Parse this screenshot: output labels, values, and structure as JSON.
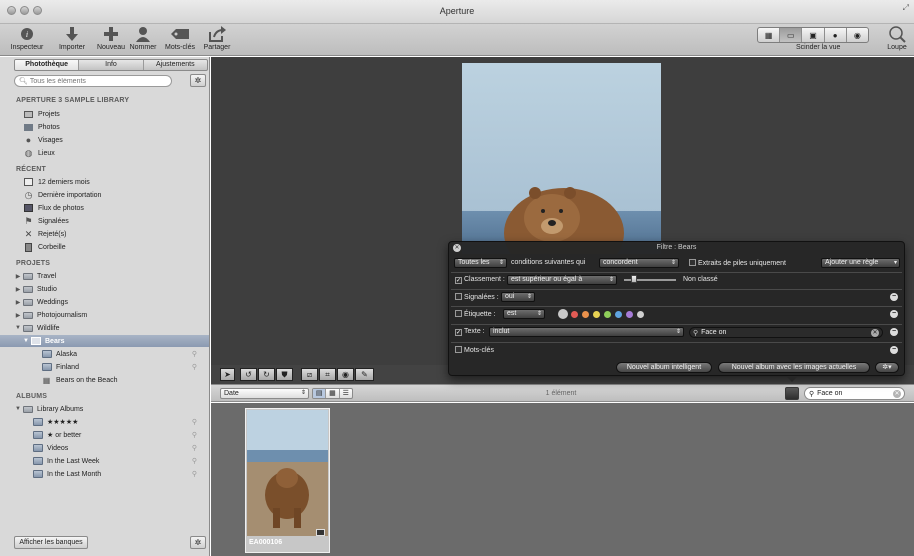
{
  "window": {
    "title": "Aperture"
  },
  "toolbar": {
    "inspector": "Inspecteur",
    "import": "Importer",
    "new": "Nouveau",
    "name": "Nommer",
    "keywords": "Mots-clés",
    "share": "Partager",
    "split_view": "Scinder la vue",
    "loupe": "Loupe"
  },
  "sidebar": {
    "tabs": [
      "Photothèque",
      "Info",
      "Ajustements"
    ],
    "search_placeholder": "Tous les éléments",
    "sections": {
      "library": "APERTURE 3 SAMPLE LIBRARY",
      "recent": "RÉCENT",
      "projects": "PROJETS",
      "albums": "ALBUMS"
    },
    "library_items": [
      "Projets",
      "Photos",
      "Visages",
      "Lieux"
    ],
    "recent_items": [
      "12 derniers mois",
      "Dernière importation",
      "Flux de photos",
      "Signalées",
      "Rejeté(s)",
      "Corbeille"
    ],
    "project_items": [
      "Travel",
      "Studio",
      "Weddings",
      "Photojournalism",
      "Wildlife"
    ],
    "wildlife_children": [
      "Bears",
      "Alaska",
      "Finland",
      "Bears on the Beach"
    ],
    "album_root": "Library Albums",
    "album_items": [
      "★★★★★",
      "★ or better",
      "Videos",
      "In the Last Week",
      "In the Last Month"
    ],
    "bank_button": "Afficher les banques"
  },
  "browser": {
    "sort": "Date",
    "count": "1 élément",
    "search_value": "Face on",
    "thumbnail_name": "EA000106"
  },
  "filter": {
    "title": "Filtre : Bears",
    "match_scope": "Toutes les",
    "match_text": "conditions suivantes qui",
    "match_mode": "concordent",
    "stacks_label": "Extraits de piles uniquement",
    "add_rule": "Ajouter une règle",
    "rating_label": "Classement :",
    "rating_op": "est supérieur ou égal à",
    "rating_value": "Non classé",
    "flagged_label": "Signalées :",
    "flagged_value": "oui",
    "label_label": "Étiquette :",
    "label_op": "est",
    "label_colors": [
      "#c9c9c9",
      "#e25b55",
      "#e9914c",
      "#e7d253",
      "#8fce5a",
      "#5fa4e0",
      "#a67cd7",
      "#cfcfcf"
    ],
    "text_label": "Texte :",
    "text_op": "inclut",
    "text_value": "Face on",
    "keywords_label": "Mots-clés",
    "smart_album_button": "Nouvel album intelligent",
    "album_with_images_button": "Nouvel album avec les images actuelles"
  }
}
